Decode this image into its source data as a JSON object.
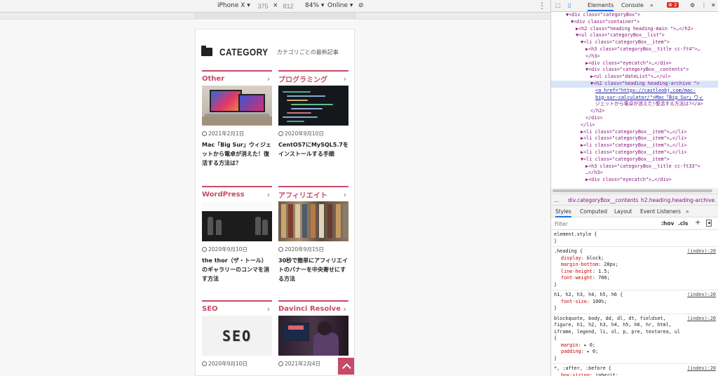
{
  "device_toolbar": {
    "device": "iPhone X",
    "width": "375",
    "times": "×",
    "height": "812",
    "zoom": "84%",
    "network": "Online"
  },
  "page": {
    "category_title": "CATEGORY",
    "category_subtitle": "カテゴリごとの最新記事",
    "cards": [
      {
        "category": "Other",
        "date": "2021年2月1日",
        "title": "Mac「Big Sur」ウィジェットから電卓が消えた！復活する方法は？"
      },
      {
        "category": "プログラミング",
        "date": "2020年9月10日",
        "title": "CentOS7にMySQL5.7をインストールする手順"
      },
      {
        "category": "WordPress",
        "date": "2020年9月10日",
        "title": "the thor（ザ・トール）のギャラリーのコンマを消す方法"
      },
      {
        "category": "アフィリエイト",
        "date": "2020年9月15日",
        "title": "30秒で簡単にアフィリエイトのバナーを中央寄せにする方法"
      },
      {
        "category": "SEO",
        "date": "2020年9月10日",
        "title": ""
      },
      {
        "category": "Davinci Resolve",
        "date": "2021年2月4日",
        "title": ""
      }
    ],
    "seo_thumb_text": "SEO"
  },
  "devtools": {
    "tabs": [
      "Elements",
      "Console",
      "»"
    ],
    "error_count": "2",
    "dom_lines": [
      {
        "indent": 3,
        "html": "▼<div class=\"categoryBox\">"
      },
      {
        "indent": 4,
        "html": "▼<div class=\"container\">"
      },
      {
        "indent": 5,
        "html": "▶<h2 class=\"heading heading-main \">…</h2>"
      },
      {
        "indent": 5,
        "html": "▼<ul class=\"categoryBox__list\">"
      },
      {
        "indent": 6,
        "html": "▼<li class=\"categoryBox__item\">"
      },
      {
        "indent": 7,
        "html": "▶<h3 class=\"categoryBox__title cc-ft4\">…"
      },
      {
        "indent": 7,
        "html": "</h3>"
      },
      {
        "indent": 7,
        "html": "▶<div class=\"eyecatch\">…</div>"
      },
      {
        "indent": 7,
        "html": "▼<div class=\"categoryBox__contents\">"
      },
      {
        "indent": 8,
        "html": "▶<ul class=\"dateList\">…</ul>"
      },
      {
        "indent": 8,
        "html": "▼<h2 class=\"heading heading-archive \">"
      },
      {
        "indent": 9,
        "html": "<a href=\"https://castleobj.com/mac-"
      },
      {
        "indent": 9,
        "html": "big-sur-calculator/\">Mac「Big Sur」ウィ"
      },
      {
        "indent": 9,
        "html": "ジェットから電卓が消えた!復活する方法は?</a>"
      },
      {
        "indent": 8,
        "html": "</h2>"
      },
      {
        "indent": 7,
        "html": "</div>"
      },
      {
        "indent": 6,
        "html": "</li>"
      },
      {
        "indent": 6,
        "html": "▶<li class=\"categoryBox__item\">…</li>"
      },
      {
        "indent": 6,
        "html": "▶<li class=\"categoryBox__item\">…</li>"
      },
      {
        "indent": 6,
        "html": "▶<li class=\"categoryBox__item\">…</li>"
      },
      {
        "indent": 6,
        "html": "▶<li class=\"categoryBox__item\">…</li>"
      },
      {
        "indent": 6,
        "html": "▼<li class=\"categoryBox__item\">"
      },
      {
        "indent": 7,
        "html": "▶<h3 class=\"categoryBox__title cc-ft33\">"
      },
      {
        "indent": 7,
        "html": "…</h3>"
      },
      {
        "indent": 7,
        "html": "▶<div class=\"eyecatch\">…</div>"
      }
    ],
    "selected_line_index": 10,
    "breadcrumbs": [
      "…",
      "div.categoryBox__contents",
      "h2.heading.heading-archive."
    ],
    "style_tabs": [
      "Styles",
      "Computed",
      "Layout",
      "Event Listeners",
      "»"
    ],
    "filter_placeholder": "Filter",
    "filter_hov": ":hov",
    "filter_cls": ".cls",
    "style_rules": [
      {
        "selector": "element.style {",
        "source": "",
        "props": [],
        "close": "}"
      },
      {
        "selector": ".heading {",
        "source": "(index):20",
        "props": [
          {
            "name": "display",
            "value": "block;"
          },
          {
            "name": "margin-bottom",
            "value": "20px;"
          },
          {
            "name": "line-height",
            "value": "1.5;"
          },
          {
            "name": "font-weight",
            "value": "700;"
          }
        ],
        "close": "}"
      },
      {
        "selector": "h1, h2, h3, h4, h5, h6 {",
        "source": "(index):20",
        "props": [
          {
            "name": "font-size",
            "value": "100%;"
          }
        ],
        "close": "}"
      },
      {
        "selector": "blockquote, body, dd, dl, dt, fieldset, figure, h1, h2, h3, h4, h5, h6, hr, html, iframe, legend, li, ol, p, pre, textarea, ul {",
        "source": "(index):20",
        "props": [
          {
            "name": "margin",
            "value": "▸ 0;"
          },
          {
            "name": "padding",
            "value": "▸ 0;"
          }
        ],
        "close": "}"
      },
      {
        "selector": "*, :after, :before {",
        "source": "(index):20",
        "props": [
          {
            "name": "box-sizing",
            "value": "inherit;"
          }
        ],
        "close": "}"
      }
    ]
  }
}
